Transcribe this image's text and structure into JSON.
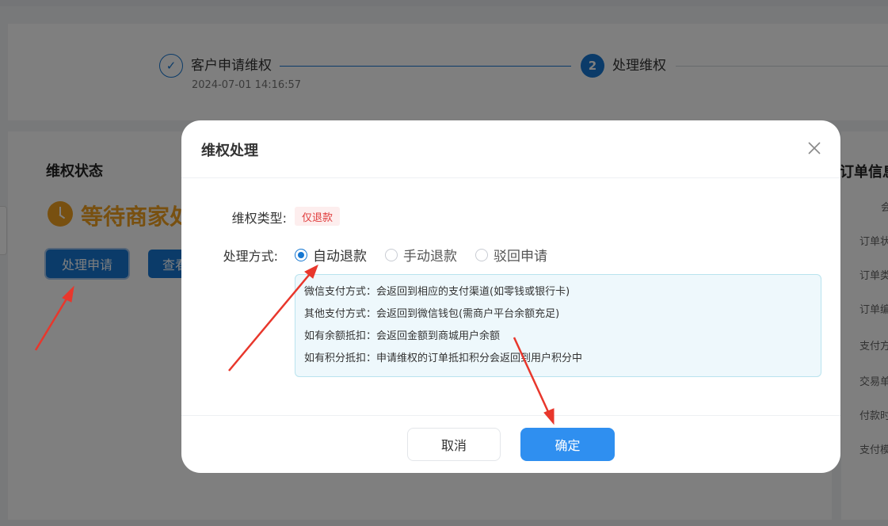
{
  "steps": {
    "step1": {
      "title": "客户申请维权",
      "time": "2024-07-01 14:16:57",
      "check": "✓"
    },
    "step2": {
      "number": "2",
      "title": "处理维权"
    }
  },
  "left_panel": {
    "title": "维权状态",
    "status": "等待商家处理",
    "process_button": "处理申请",
    "view_button": "查看"
  },
  "right_panel": {
    "title": "订单信息",
    "labels": [
      "会",
      "订单状",
      "订单类",
      "订单编",
      "支付方",
      "交易单",
      "付款时",
      "支付模"
    ]
  },
  "modal": {
    "title": "维权处理",
    "type_label": "维权类型:",
    "type_value": "仅退款",
    "method_label": "处理方式:",
    "options": [
      "自动退款",
      "手动退款",
      "驳回申请"
    ],
    "selected_option": "自动退款",
    "info_lines": [
      "微信支付方式：会返回到相应的支付渠道(如零钱或银行卡)",
      "其他支付方式：会返回到微信钱包(需商户平台余额充足)",
      "如有余额抵扣：会返回金额到商城用户余额",
      "如有积分抵扣：申请维权的订单抵扣积分会返回到用户积分中"
    ],
    "cancel_button": "取消",
    "confirm_button": "确定"
  },
  "colors": {
    "primary": "#1677d2",
    "confirm": "#2f8ff0",
    "warning": "#f0a020",
    "tag_red": "#e03c3c",
    "annotation_arrow": "#e8372c"
  }
}
